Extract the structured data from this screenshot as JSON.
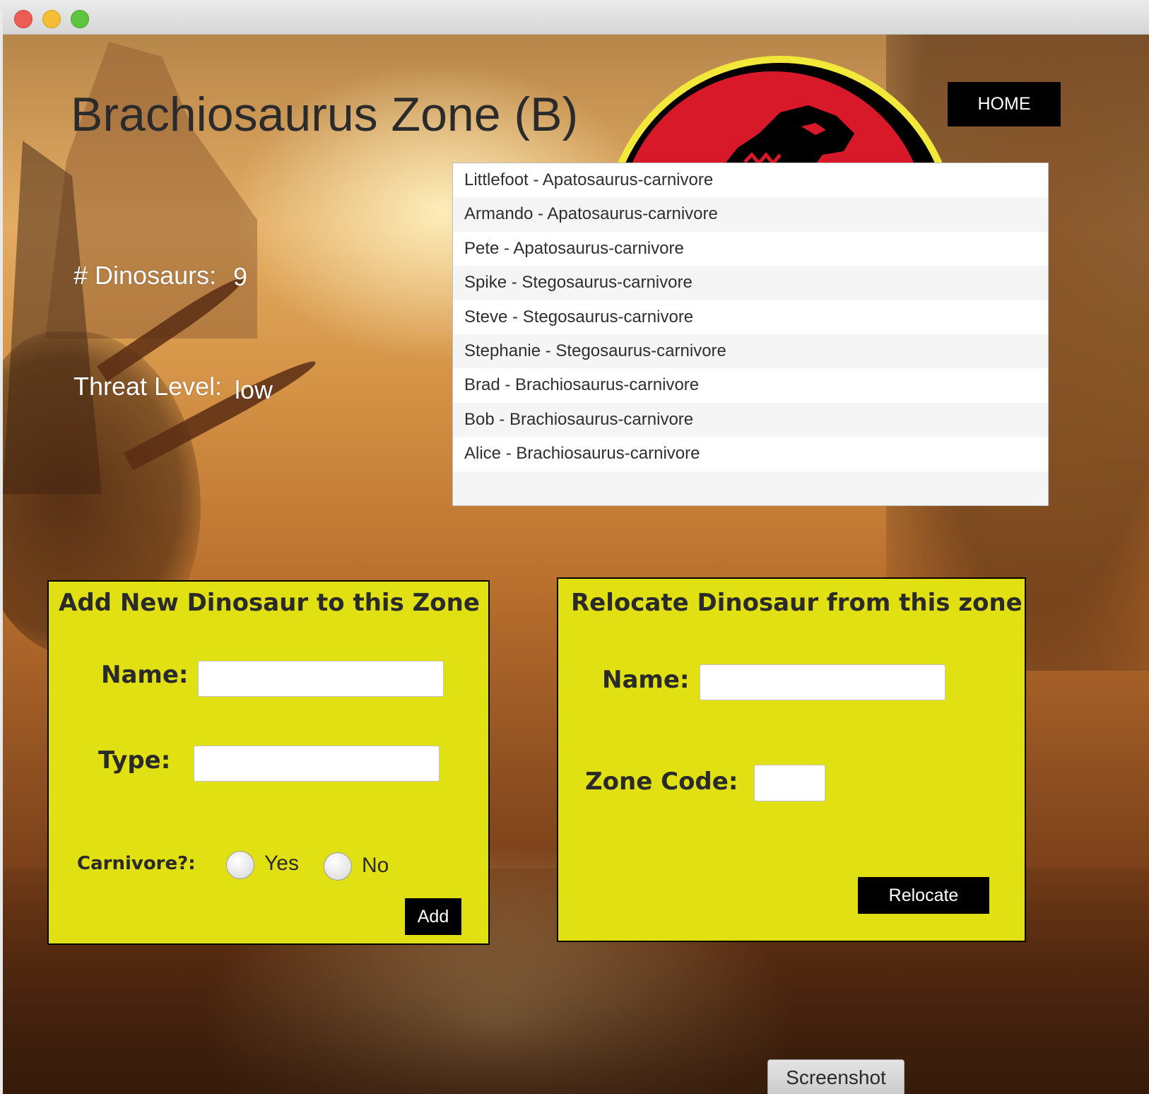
{
  "window": {
    "controls": [
      "close",
      "minimize",
      "zoom"
    ]
  },
  "header": {
    "zone_title": "Brachiosaurus Zone (B)",
    "home_label": "HOME"
  },
  "stats": {
    "dinosaurs_label": "# Dinosaurs:",
    "dinosaurs_value": "9",
    "threat_label": "Threat Level:",
    "threat_value": "low"
  },
  "dinosaur_list": [
    "Littlefoot - Apatosaurus-carnivore",
    "Armando - Apatosaurus-carnivore",
    "Pete - Apatosaurus-carnivore",
    "Spike - Stegosaurus-carnivore",
    "Steve - Stegosaurus-carnivore",
    "Stephanie - Stegosaurus-carnivore",
    "Brad - Brachiosaurus-carnivore",
    "Bob - Brachiosaurus-carnivore",
    "Alice - Brachiosaurus-carnivore"
  ],
  "add_panel": {
    "title": "Add New Dinosaur to this Zone",
    "name_label": "Name:",
    "name_value": "",
    "type_label": "Type:",
    "type_value": "",
    "carnivore_label": "Carnivore?:",
    "yes_label": "Yes",
    "no_label": "No",
    "add_label": "Add"
  },
  "relocate_panel": {
    "title": "Relocate Dinosaur from this zone",
    "name_label": "Name:",
    "name_value": "",
    "zone_code_label": "Zone Code:",
    "zone_code_value": "",
    "relocate_label": "Relocate"
  },
  "footer": {
    "screenshot_label": "Screenshot"
  },
  "colors": {
    "panel": "#e0e013",
    "button": "#000000",
    "logo_ring": "#f1e83a",
    "logo_red": "#d8192a"
  },
  "icons": {
    "logo": "jurassic-park-logo-icon"
  }
}
